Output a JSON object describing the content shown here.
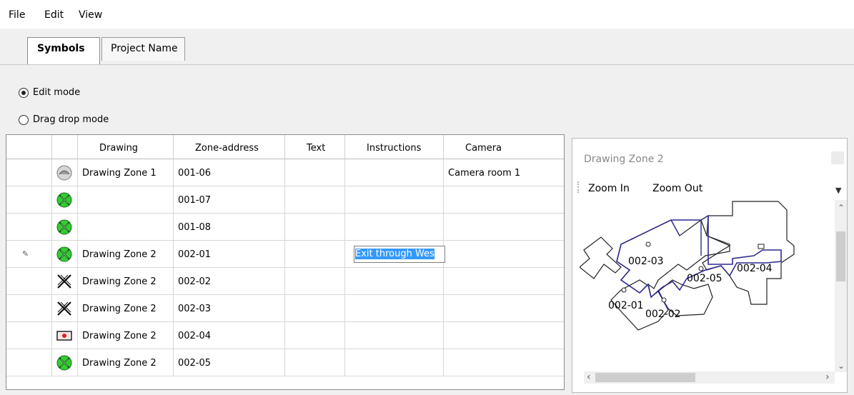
{
  "menu": {
    "file": "File",
    "edit": "Edit",
    "view": "View"
  },
  "tabs": {
    "symbols": "Symbols",
    "project": "Project Name"
  },
  "modes": {
    "edit": "Edit mode",
    "dragdrop": "Drag drop mode",
    "selected": "edit"
  },
  "grid": {
    "headers": {
      "drawing": "Drawing",
      "zone": "Zone-address",
      "text": "Text",
      "instructions": "Instructions",
      "camera": "Camera"
    },
    "rows": [
      {
        "symbol": "gray-person-icon",
        "drawing": "Drawing Zone 1",
        "zone": "001-06",
        "camera": "Camera room 1"
      },
      {
        "symbol": "green-crossed-icon",
        "drawing": "",
        "zone": "001-07",
        "camera": ""
      },
      {
        "symbol": "green-crossed-icon",
        "drawing": "",
        "zone": "001-08",
        "camera": ""
      },
      {
        "symbol": "green-crossed-icon",
        "drawing": "Drawing Zone 2",
        "zone": "002-01",
        "camera": ""
      },
      {
        "symbol": "black-x-icon",
        "drawing": "Drawing Zone 2",
        "zone": "002-02",
        "camera": ""
      },
      {
        "symbol": "black-x-icon",
        "drawing": "Drawing Zone 2",
        "zone": "002-03",
        "camera": ""
      },
      {
        "symbol": "red-dot-box-icon",
        "drawing": "Drawing Zone 2",
        "zone": "002-04",
        "camera": ""
      },
      {
        "symbol": "green-crossed-icon",
        "drawing": "Drawing Zone 2",
        "zone": "002-05",
        "camera": ""
      }
    ],
    "editing_value": "Exit through Wes"
  },
  "panel": {
    "title": "Drawing Zone 2",
    "zoom_in": "Zoom In",
    "zoom_out": "Zoom Out",
    "labels": {
      "z1": "002-03",
      "z2": "002-05",
      "z3": "002-04",
      "z4": "002-01",
      "z5": "002-02"
    }
  },
  "colors": {
    "selection": "#3399ff",
    "symbol_green": "#33cc33",
    "zone_outline": "#2c2a8f",
    "symbol_red": "#e01b1b"
  }
}
